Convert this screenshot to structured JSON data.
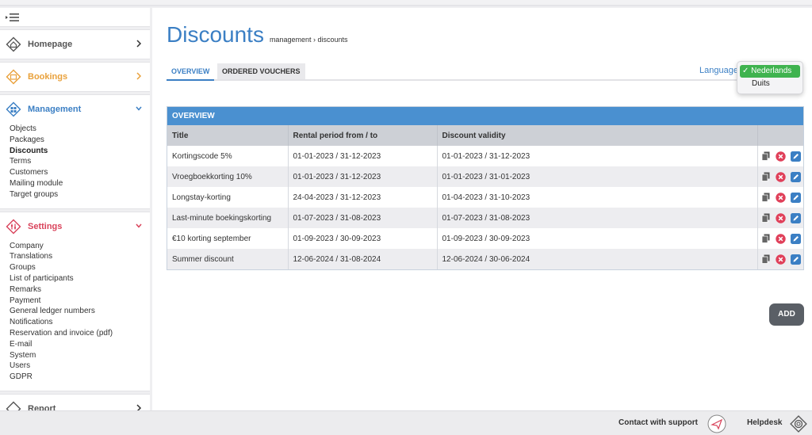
{
  "sidebar": {
    "sections": [
      {
        "label": "Homepage",
        "color": "#555555"
      },
      {
        "label": "Bookings",
        "color": "#e9a13b"
      },
      {
        "label": "Management",
        "color": "#3b7fc4"
      },
      {
        "label": "Settings",
        "color": "#d9435b"
      },
      {
        "label": "Report",
        "color": "#555555"
      }
    ],
    "management_items": [
      "Objects",
      "Packages",
      "Discounts",
      "Terms",
      "Customers",
      "Mailing module",
      "Target groups"
    ],
    "settings_items": [
      "Company",
      "Translations",
      "Groups",
      "List of participants",
      "Remarks",
      "Payment",
      "General ledger numbers",
      "Notifications",
      "Reservation and invoice (pdf)",
      "E-mail",
      "System",
      "Users",
      "GDPR"
    ]
  },
  "header": {
    "title": "Discounts",
    "breadcrumb": "management › discounts"
  },
  "tabs": [
    {
      "label": "Overview"
    },
    {
      "label": "Ordered vouchers"
    }
  ],
  "language": {
    "label": "Language",
    "selected": "✓ Nederlands",
    "other": "Duits"
  },
  "panel": {
    "title": "Overview",
    "columns": [
      "Title",
      "Rental period from / to",
      "Discount validity"
    ],
    "rows": [
      [
        "Kortingscode 5%",
        "01-01-2023 / 31-12-2023",
        "01-01-2023 / 31-12-2023"
      ],
      [
        "Vroegboekkorting 10%",
        "01-01-2023 / 31-12-2023",
        "01-01-2023 / 31-01-2023"
      ],
      [
        "Longstay-korting",
        "24-04-2023 / 31-12-2023",
        "01-04-2023 / 31-10-2023"
      ],
      [
        "Last-minute boekingskorting",
        "01-07-2023 / 31-08-2023",
        "01-07-2023 / 31-08-2023"
      ],
      [
        "€10 korting september",
        "01-09-2023 / 30-09-2023",
        "01-09-2023 / 30-09-2023"
      ],
      [
        "Summer discount",
        "12-06-2024 / 31-08-2024",
        "12-06-2024 / 30-06-2024"
      ]
    ]
  },
  "add_button": "ADD",
  "footer": {
    "support": "Contact with support",
    "helpdesk": "Helpdesk"
  },
  "colors": {
    "accent": "#3b7fc4",
    "panel_header": "#4a90d0",
    "delete": "#e0405a",
    "selected_language": "#3fb34f"
  }
}
